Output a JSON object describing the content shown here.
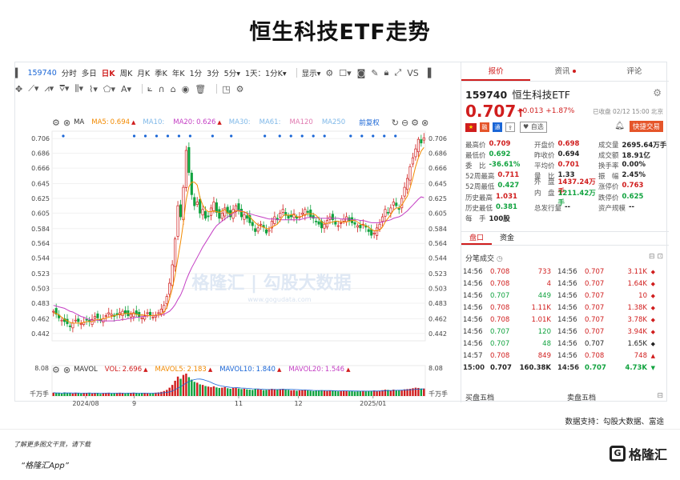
{
  "headline": "恒生科技ETF走势",
  "toolbar": {
    "code": "159740",
    "periods": [
      "分时",
      "多日",
      "日K",
      "周K",
      "月K",
      "季K",
      "年K",
      "1分",
      "3分",
      "5分▾",
      "1天：1分K▾"
    ],
    "selected_period": "日K",
    "display_label": "显示▾"
  },
  "ma_bar": {
    "ma_label": "MA",
    "items": [
      {
        "label": "MA5:",
        "value": "0.694",
        "arrow": "▲",
        "color": "#f28a00"
      },
      {
        "label": "MA10:",
        "value": "",
        "arrow": "",
        "color": "#7fb8e8"
      },
      {
        "label": "MA20:",
        "value": "0.626",
        "arrow": "▲",
        "color": "#c43fc4"
      },
      {
        "label": "MA30:",
        "value": "",
        "arrow": "",
        "color": "#7fb8e8"
      },
      {
        "label": "MA61:",
        "value": "",
        "arrow": "",
        "color": "#7fb8e8"
      },
      {
        "label": "MA120",
        "value": "",
        "arrow": "",
        "color": "#e07ab0"
      },
      {
        "label": "MA250",
        "value": "",
        "arrow": "",
        "color": "#7fb8e8"
      }
    ],
    "adjust": "前复权"
  },
  "vol_bar": {
    "label": "MAVOL",
    "items": [
      {
        "label": "VOL:",
        "value": "2.696",
        "arrow": "▲",
        "color": "#d01d1d"
      },
      {
        "label": "MAVOL5:",
        "value": "2.183",
        "arrow": "▲",
        "color": "#f28a00"
      },
      {
        "label": "MAVOL10:",
        "value": "1.840",
        "arrow": "▲",
        "color": "#1a66d6"
      },
      {
        "label": "MAVOL20:",
        "value": "1.546",
        "arrow": "▲",
        "color": "#c43fc4"
      }
    ]
  },
  "chart_data": {
    "type": "candlestick",
    "y_ticks": [
      "0.706",
      "0.686",
      "0.666",
      "0.645",
      "0.625",
      "0.605",
      "0.584",
      "0.564",
      "0.544",
      "0.523",
      "0.503",
      "0.483",
      "0.462",
      "0.442"
    ],
    "ylim": [
      0.432,
      0.716
    ],
    "x_ticks": [
      "2024/08",
      "9",
      "11",
      "12",
      "2025/01"
    ],
    "x_tick_positions": [
      0.09,
      0.22,
      0.5,
      0.66,
      0.86
    ],
    "vol_ticks": [
      "8.08",
      "千万手"
    ],
    "watermark": "格隆汇 | 勾股大数据",
    "watermark_sub": "www.gogudata.com",
    "close": [
      0.472,
      0.468,
      0.463,
      0.46,
      0.458,
      0.455,
      0.452,
      0.456,
      0.46,
      0.458,
      0.455,
      0.457,
      0.46,
      0.458,
      0.461,
      0.465,
      0.463,
      0.46,
      0.462,
      0.466,
      0.47,
      0.468,
      0.465,
      0.467,
      0.47,
      0.472,
      0.469,
      0.466,
      0.468,
      0.47,
      0.468,
      0.465,
      0.463,
      0.466,
      0.47,
      0.467,
      0.464,
      0.466,
      0.47,
      0.475,
      0.48,
      0.492,
      0.51,
      0.535,
      0.57,
      0.615,
      0.6,
      0.64,
      0.69,
      0.66,
      0.63,
      0.615,
      0.62,
      0.605,
      0.61,
      0.598,
      0.6,
      0.612,
      0.62,
      0.606,
      0.598,
      0.605,
      0.612,
      0.605,
      0.6,
      0.61,
      0.615,
      0.608,
      0.6,
      0.603,
      0.598,
      0.592,
      0.588,
      0.58,
      0.585,
      0.59,
      0.586,
      0.578,
      0.582,
      0.594,
      0.6,
      0.596,
      0.605,
      0.61,
      0.602,
      0.598,
      0.6,
      0.604,
      0.598,
      0.6,
      0.605,
      0.61,
      0.606,
      0.6,
      0.598,
      0.594,
      0.59,
      0.585,
      0.59,
      0.595,
      0.6,
      0.596,
      0.59,
      0.588,
      0.592,
      0.597,
      0.6,
      0.595,
      0.592,
      0.59,
      0.588,
      0.585,
      0.59,
      0.586,
      0.58,
      0.575,
      0.578,
      0.585,
      0.59,
      0.6,
      0.61,
      0.605,
      0.612,
      0.62,
      0.615,
      0.61,
      0.625,
      0.64,
      0.652,
      0.668,
      0.68,
      0.692,
      0.705,
      0.7,
      0.707
    ],
    "ma5": [
      0.47,
      0.469,
      0.467,
      0.464,
      0.461,
      0.459,
      0.457,
      0.456,
      0.456,
      0.456,
      0.456,
      0.457,
      0.458,
      0.458,
      0.458,
      0.46,
      0.461,
      0.461,
      0.462,
      0.463,
      0.464,
      0.465,
      0.466,
      0.467,
      0.468,
      0.468,
      0.469,
      0.469,
      0.469,
      0.469,
      0.468,
      0.467,
      0.467,
      0.467,
      0.466,
      0.466,
      0.466,
      0.467,
      0.467,
      0.468,
      0.471,
      0.477,
      0.489,
      0.503,
      0.521,
      0.544,
      0.566,
      0.592,
      0.623,
      0.641,
      0.647,
      0.647,
      0.643,
      0.626,
      0.616,
      0.61,
      0.607,
      0.607,
      0.608,
      0.607,
      0.606,
      0.608,
      0.61,
      0.605,
      0.604,
      0.606,
      0.608,
      0.608,
      0.607,
      0.607,
      0.605,
      0.6,
      0.596,
      0.592,
      0.589,
      0.587,
      0.586,
      0.584,
      0.584,
      0.586,
      0.588,
      0.59,
      0.595,
      0.601,
      0.603,
      0.602,
      0.603,
      0.603,
      0.6,
      0.6,
      0.601,
      0.603,
      0.604,
      0.604,
      0.604,
      0.602,
      0.598,
      0.593,
      0.591,
      0.591,
      0.592,
      0.593,
      0.594,
      0.594,
      0.593,
      0.593,
      0.593,
      0.594,
      0.595,
      0.595,
      0.593,
      0.59,
      0.589,
      0.588,
      0.586,
      0.583,
      0.581,
      0.581,
      0.582,
      0.586,
      0.593,
      0.598,
      0.603,
      0.609,
      0.612,
      0.612,
      0.616,
      0.622,
      0.628,
      0.639,
      0.653,
      0.668,
      0.68,
      0.689,
      0.694
    ],
    "ma20": [
      0.48,
      0.479,
      0.478,
      0.477,
      0.476,
      0.474,
      0.472,
      0.471,
      0.469,
      0.467,
      0.465,
      0.464,
      0.462,
      0.461,
      0.46,
      0.46,
      0.46,
      0.459,
      0.459,
      0.459,
      0.459,
      0.459,
      0.459,
      0.46,
      0.46,
      0.461,
      0.461,
      0.462,
      0.462,
      0.463,
      0.464,
      0.464,
      0.465,
      0.465,
      0.466,
      0.466,
      0.466,
      0.466,
      0.467,
      0.467,
      0.468,
      0.47,
      0.472,
      0.476,
      0.481,
      0.488,
      0.494,
      0.503,
      0.514,
      0.523,
      0.531,
      0.538,
      0.545,
      0.552,
      0.559,
      0.565,
      0.571,
      0.577,
      0.583,
      0.588,
      0.591,
      0.594,
      0.597,
      0.6,
      0.602,
      0.605,
      0.607,
      0.609,
      0.608,
      0.606,
      0.605,
      0.604,
      0.603,
      0.602,
      0.601,
      0.6,
      0.599,
      0.598,
      0.597,
      0.597,
      0.597,
      0.596,
      0.596,
      0.596,
      0.596,
      0.596,
      0.596,
      0.596,
      0.596,
      0.596,
      0.597,
      0.598,
      0.599,
      0.599,
      0.599,
      0.599,
      0.598,
      0.598,
      0.598,
      0.598,
      0.598,
      0.598,
      0.598,
      0.598,
      0.597,
      0.597,
      0.597,
      0.597,
      0.596,
      0.596,
      0.596,
      0.595,
      0.595,
      0.594,
      0.593,
      0.592,
      0.592,
      0.592,
      0.592,
      0.593,
      0.594,
      0.595,
      0.596,
      0.598,
      0.599,
      0.6,
      0.602,
      0.605,
      0.608,
      0.612,
      0.616,
      0.62,
      0.624,
      0.627,
      0.626
    ],
    "volume": [
      1.2,
      1.0,
      1.1,
      0.9,
      1.3,
      1.0,
      1.1,
      0.9,
      1.2,
      1.0,
      0.9,
      1.1,
      1.0,
      1.2,
      0.9,
      1.1,
      1.0,
      0.8,
      1.0,
      1.1,
      1.2,
      0.9,
      1.0,
      1.1,
      1.2,
      1.0,
      0.9,
      1.0,
      1.1,
      1.2,
      1.0,
      0.9,
      1.0,
      1.1,
      1.0,
      0.9,
      1.0,
      1.2,
      1.3,
      1.5,
      1.8,
      2.2,
      3.0,
      4.0,
      5.5,
      7.0,
      6.2,
      7.6,
      8.08,
      6.8,
      5.9,
      5.1,
      4.8,
      4.2,
      4.0,
      3.6,
      3.4,
      3.2,
      3.5,
      3.1,
      2.9,
      3.0,
      3.2,
      2.8,
      2.6,
      2.9,
      3.0,
      2.7,
      2.5,
      2.6,
      2.4,
      2.3,
      2.2,
      2.5,
      2.4,
      2.3,
      2.1,
      2.2,
      2.4,
      2.6,
      2.5,
      2.3,
      2.5,
      2.6,
      2.3,
      2.2,
      2.0,
      2.1,
      1.9,
      2.0,
      2.1,
      2.2,
      2.0,
      1.9,
      1.8,
      1.9,
      2.0,
      2.1,
      1.9,
      1.8,
      1.9,
      2.0,
      1.8,
      1.7,
      1.8,
      1.9,
      1.8,
      1.7,
      1.8,
      1.6,
      1.7,
      1.8,
      1.9,
      1.7,
      1.8,
      1.9,
      2.0,
      1.8,
      1.9,
      2.1,
      2.3,
      2.2,
      2.0,
      2.3,
      2.1,
      2.0,
      2.2,
      2.4,
      2.5,
      2.6,
      2.8,
      3.0,
      2.9,
      2.7,
      2.696
    ]
  },
  "right": {
    "tabs": [
      "报价",
      "资讯",
      "评论"
    ],
    "code": "159740",
    "name": "恒生科技ETF",
    "price": "0.707",
    "arrow": "↑",
    "change": "+0.013",
    "change_pct": "+1.87%",
    "datetime": "已收盘 02/12 15:00 北京",
    "watch_label": "自选",
    "fast_trade": "快捷交易",
    "stats": [
      [
        {
          "l": "最高价",
          "v": "0.709",
          "c": "r"
        },
        {
          "l": "开盘价",
          "v": "0.698",
          "c": "r"
        },
        {
          "l": "成交量",
          "v": "2695.64万手",
          "c": "k"
        }
      ],
      [
        {
          "l": "最低价",
          "v": "0.692",
          "c": "g"
        },
        {
          "l": "昨收价",
          "v": "0.694",
          "c": "k"
        },
        {
          "l": "成交额",
          "v": "18.91亿",
          "c": "k"
        }
      ],
      [
        {
          "l": "委　比",
          "v": "-36.61%",
          "c": "g"
        },
        {
          "l": "平均价",
          "v": "0.701",
          "c": "r"
        },
        {
          "l": "换手率",
          "v": "0.00%",
          "c": "k"
        }
      ],
      [
        {
          "l": "52周最高",
          "v": "0.711",
          "c": "r"
        },
        {
          "l": "量　比",
          "v": "1.33",
          "c": "k"
        },
        {
          "l": "振　幅",
          "v": "2.45%",
          "c": "k"
        }
      ],
      [
        {
          "l": "52周最低",
          "v": "0.427",
          "c": "g"
        },
        {
          "l": "外　盘",
          "v": "1437.24万手",
          "c": "r"
        },
        {
          "l": "涨停价",
          "v": "0.763",
          "c": "r"
        }
      ],
      [
        {
          "l": "历史最高",
          "v": "1.031",
          "c": "r"
        },
        {
          "l": "内　盘",
          "v": "1211.42万手",
          "c": "g"
        },
        {
          "l": "跌停价",
          "v": "0.625",
          "c": "g"
        }
      ],
      [
        {
          "l": "历史最低",
          "v": "0.381",
          "c": "g"
        },
        {
          "l": "总发行量",
          "v": "--",
          "c": "k"
        },
        {
          "l": "资产规模",
          "v": "--",
          "c": "k"
        }
      ],
      [
        {
          "l": "每　手",
          "v": "100股",
          "c": "k"
        },
        {
          "l": "",
          "v": "",
          "c": "k"
        },
        {
          "l": "",
          "v": "",
          "c": "k"
        }
      ]
    ],
    "subtabs": [
      "盘口",
      "资金"
    ],
    "trades_title": "分笔成交",
    "trades": [
      {
        "t1": "14:56",
        "p1": "0.708",
        "v1": "733",
        "c1": "r",
        "f1": "▲",
        "t2": "14:56",
        "p2": "0.707",
        "v2": "3.11K",
        "c2": "r",
        "f2": "◆"
      },
      {
        "t1": "14:56",
        "p1": "0.708",
        "v1": "4",
        "c1": "r",
        "f1": "▲",
        "t2": "14:56",
        "p2": "0.707",
        "v2": "1.64K",
        "c2": "r",
        "f2": "◆"
      },
      {
        "t1": "14:56",
        "p1": "0.707",
        "v1": "449",
        "c1": "g",
        "f1": "▼",
        "t2": "14:56",
        "p2": "0.707",
        "v2": "10",
        "c2": "r",
        "f2": "◆"
      },
      {
        "t1": "14:56",
        "p1": "0.708",
        "v1": "1.11K",
        "c1": "r",
        "f1": "▲",
        "t2": "14:56",
        "p2": "0.707",
        "v2": "1.38K",
        "c2": "r",
        "f2": "◆"
      },
      {
        "t1": "14:56",
        "p1": "0.708",
        "v1": "1.01K",
        "c1": "r",
        "f1": "▲",
        "t2": "14:56",
        "p2": "0.707",
        "v2": "3.78K",
        "c2": "r",
        "f2": "◆"
      },
      {
        "t1": "14:56",
        "p1": "0.707",
        "v1": "120",
        "c1": "g",
        "f1": "▼",
        "t2": "14:56",
        "p2": "0.707",
        "v2": "3.94K",
        "c2": "r",
        "f2": "◆"
      },
      {
        "t1": "14:56",
        "p1": "0.707",
        "v1": "48",
        "c1": "g",
        "f1": "▼",
        "t2": "14:56",
        "p2": "0.707",
        "v2": "1.65K",
        "c2": "k",
        "f2": "◆"
      },
      {
        "t1": "14:57",
        "p1": "0.708",
        "v1": "849",
        "c1": "r",
        "f1": "▲",
        "t2": "14:56",
        "p2": "0.708",
        "v2": "748",
        "c2": "r",
        "f2": "▲"
      },
      {
        "t1": "15:00",
        "p1": "0.707",
        "v1": "160.38K",
        "c1": "k",
        "f1": "◆",
        "t2": "14:56",
        "p2": "0.707",
        "v2": "4.73K",
        "c2": "g",
        "f2": "▼"
      }
    ],
    "buy5": "买盘五档",
    "sell5": "卖盘五档"
  },
  "source": "数据支持：勾股大数据、富途",
  "footer": {
    "line1": "了解更多图文干货，请下载",
    "line2": "“格隆汇App”",
    "logo": "格隆汇"
  }
}
